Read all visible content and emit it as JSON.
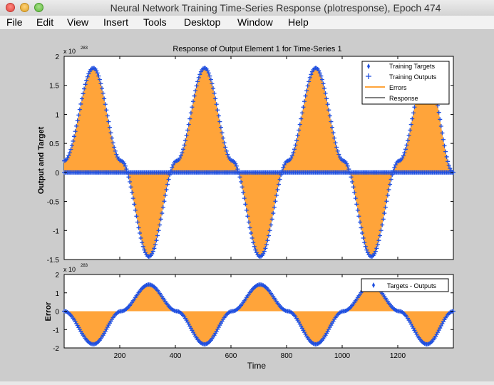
{
  "window": {
    "title": "Neural Network Training Time-Series Response (plotresponse), Epoch 474"
  },
  "menu": [
    "File",
    "Edit",
    "View",
    "Insert",
    "Tools",
    "Desktop",
    "Window",
    "Help"
  ],
  "colors": {
    "series": "#1f4fe0",
    "error_fill": "#ffa43a",
    "axes_bg": "#ffffff",
    "figure_bg": "#cccccc"
  },
  "chart_data": [
    {
      "type": "line",
      "title": "Response of Output Element 1 for Time-Series 1",
      "xlabel": "",
      "ylabel": "Output and Target",
      "exponent_label": "x 10",
      "exponent_value": "283",
      "xlim": [
        0,
        1400
      ],
      "ylim": [
        -1.5,
        2
      ],
      "yticks": [
        "-1.5",
        "-1",
        "-0.5",
        "0",
        "0.5",
        "1",
        "1.5",
        "2"
      ],
      "grid": false,
      "legend_position": "top-right",
      "legend": [
        "Training Targets",
        "Training Outputs",
        "Errors",
        "Response"
      ],
      "series": [
        {
          "name": "Training Targets",
          "x": [
            0,
            105,
            205,
            305,
            405,
            505,
            605,
            705,
            805,
            905,
            1005,
            1105,
            1205,
            1305,
            1400
          ],
          "values": [
            0.2,
            1.8,
            0.2,
            -1.45,
            0.2,
            1.8,
            0.2,
            -1.45,
            0.2,
            1.8,
            0.2,
            -1.45,
            0.2,
            1.8,
            0.0
          ]
        },
        {
          "name": "Training Outputs",
          "x": [
            0,
            1400
          ],
          "values": [
            0,
            0
          ]
        }
      ]
    },
    {
      "type": "line",
      "title": "",
      "xlabel": "Time",
      "ylabel": "Error",
      "exponent_label": "x 10",
      "exponent_value": "283",
      "xlim": [
        0,
        1400
      ],
      "ylim": [
        -2,
        2
      ],
      "xticks": [
        "200",
        "400",
        "600",
        "800",
        "1000",
        "1200"
      ],
      "yticks": [
        "-2",
        "-1",
        "0",
        "1",
        "2"
      ],
      "grid": false,
      "legend_position": "top-right",
      "legend": [
        "Targets - Outputs"
      ],
      "series": [
        {
          "name": "Targets - Outputs",
          "x": [
            0,
            105,
            205,
            305,
            405,
            505,
            605,
            705,
            805,
            905,
            1005,
            1105,
            1205,
            1305,
            1400
          ],
          "values": [
            0,
            -1.8,
            0,
            1.45,
            0,
            -1.8,
            0,
            1.45,
            0,
            -1.8,
            0,
            1.45,
            0,
            -1.8,
            0
          ]
        }
      ]
    }
  ]
}
